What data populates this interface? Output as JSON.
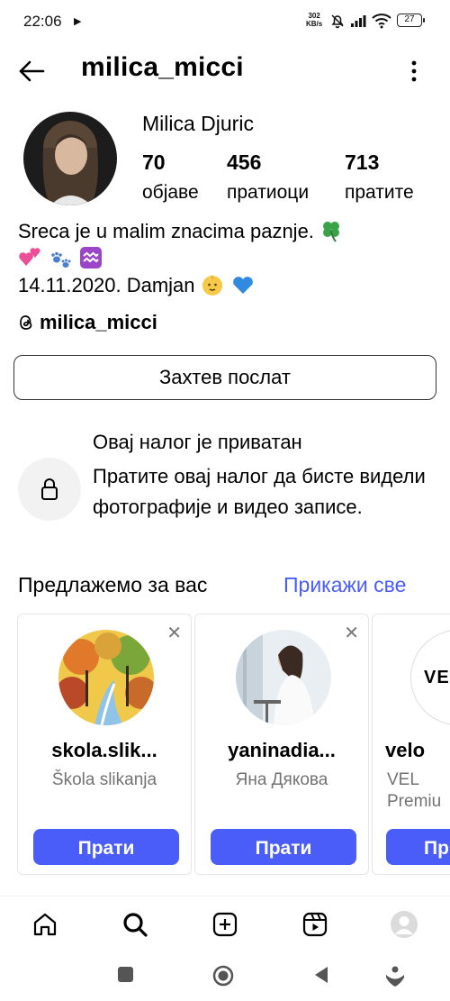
{
  "status_bar": {
    "time": "22:06",
    "net_speed_value": "302",
    "net_speed_unit": "KB/s",
    "battery": "27"
  },
  "header": {
    "title": "milica_micci"
  },
  "profile": {
    "full_name": "Milica Djuric",
    "stats": [
      {
        "count": "70",
        "label": "објаве"
      },
      {
        "count": "456",
        "label": "пратиоци"
      },
      {
        "count": "713",
        "label": "пратите"
      }
    ],
    "bio_line1": "Sreca je u malim znacima paznje.",
    "bio_line3": "14.11.2020. Damjan",
    "threads_handle": "milica_micci",
    "request_button": "Захтев послат"
  },
  "private_notice": {
    "title": "Овај налог је приватан",
    "description": "Пратите овај налог да бисте видели фотографије и видео записе."
  },
  "suggestions": {
    "title": "Предлажемо за вас",
    "see_all": "Прикажи све",
    "cards": [
      {
        "username": "skola.slik...",
        "subtitle": "Škola slikanja",
        "follow": "Прати"
      },
      {
        "username": "yaninadia...",
        "subtitle": "Яна Дякова",
        "follow": "Прати"
      },
      {
        "username": "velo",
        "subtitle": "VEL",
        "subtitle2": "Premiu",
        "logo_text": "VEL",
        "follow": "Пр"
      }
    ]
  },
  "colors": {
    "accent": "#4a5df9",
    "secondary_text": "#737373"
  },
  "icons": {
    "nav": [
      "home-icon",
      "search-icon",
      "new-post-icon",
      "reels-icon",
      "profile-icon"
    ],
    "system": [
      "recents-square-icon",
      "home-circle-icon",
      "back-triangle-icon",
      "assistant-icon"
    ]
  }
}
